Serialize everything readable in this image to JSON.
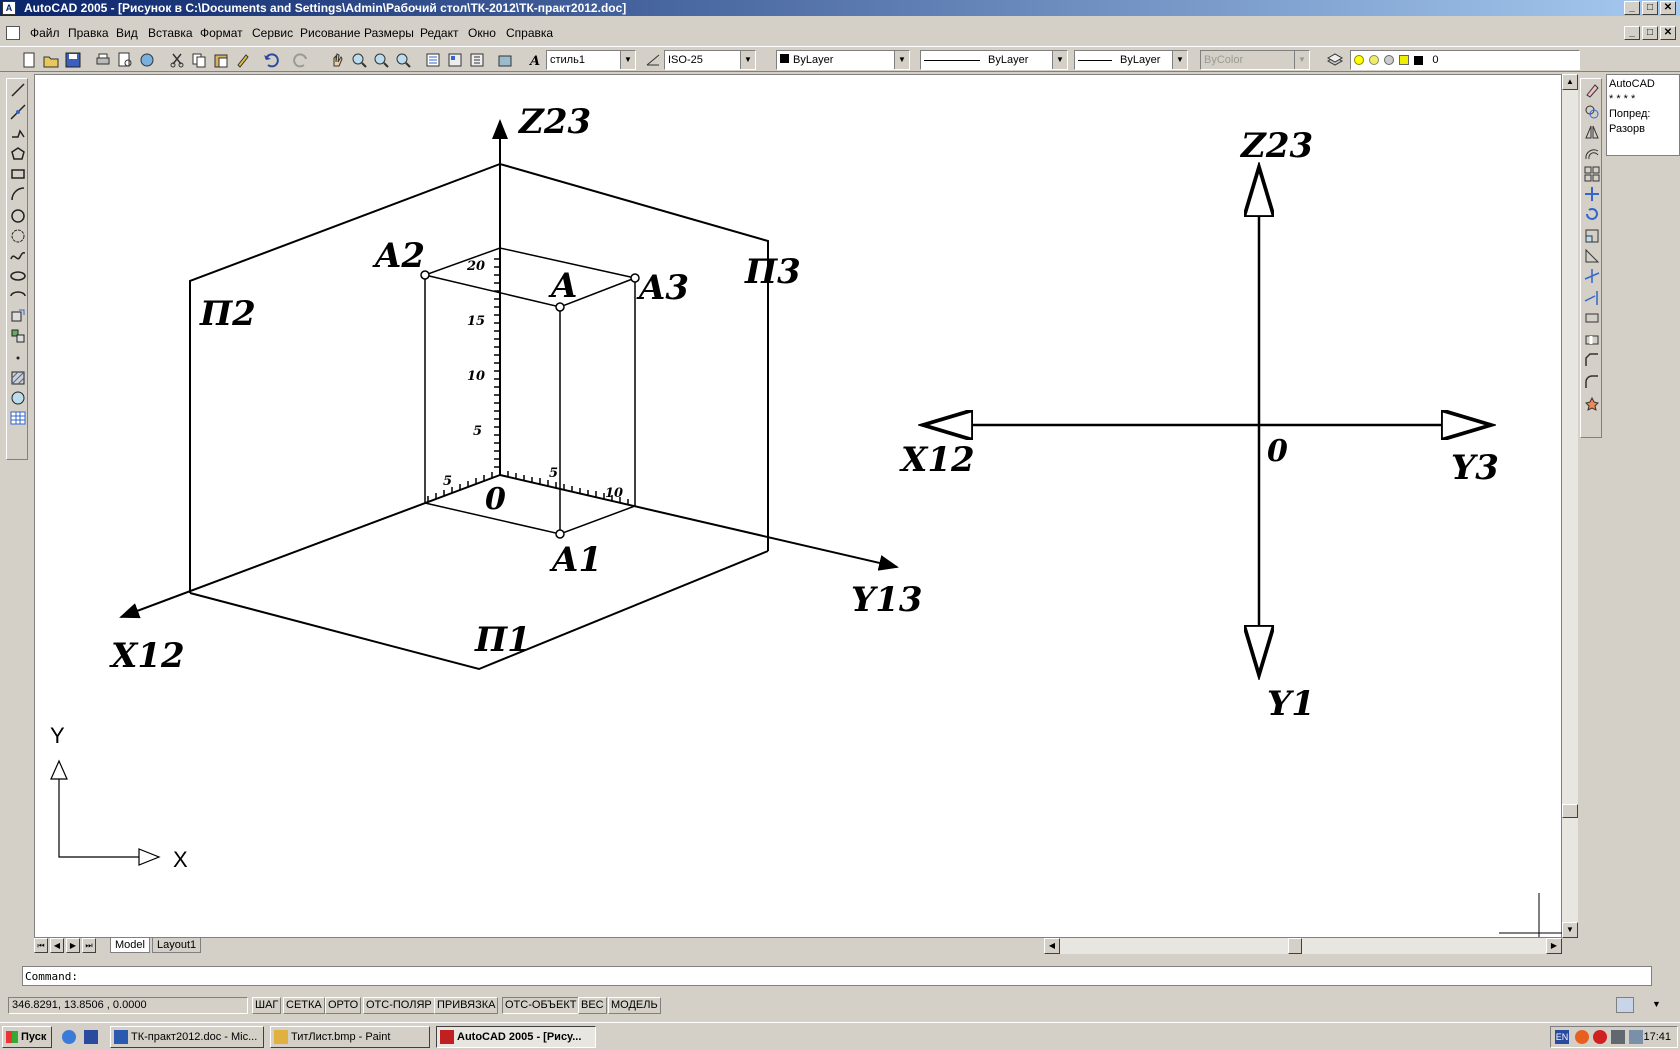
{
  "window": {
    "title": "AutoCAD 2005 - [Рисунок в C:\\Documents and Settings\\Admin\\Рабочий стол\\ТК-2012\\ТК-практ2012.doc]",
    "buttons": [
      "_",
      "□",
      "✕"
    ]
  },
  "menu": [
    "Файл",
    "Правка",
    "Вид",
    "Вставка",
    "Формат",
    "Сервис",
    "Рисование",
    "Размеры",
    "Редакт",
    "Окно",
    "Справка"
  ],
  "toolbar": {
    "text_style": "стиль1",
    "dim_style": "ISO-25",
    "color": "ByLayer",
    "linetype": "ByLayer",
    "lineweight": "ByLayer",
    "plotstyle": "ByColor",
    "layer": "0"
  },
  "drawing": {
    "left": {
      "labels": {
        "z": "Z23",
        "x": "X12",
        "y": "Y13",
        "p1": "П1",
        "p2": "П2",
        "p3": "П3",
        "a": "A",
        "a1": "A1",
        "a2": "A2",
        "a3": "A3",
        "origin": "0"
      },
      "z_ticks": [
        "5",
        "10",
        "15",
        "20"
      ],
      "x_ticks": [
        "5"
      ],
      "y_ticks": [
        "5",
        "10"
      ]
    },
    "right": {
      "labels": {
        "z": "Z23",
        "x": "X12",
        "y3": "Y3",
        "y1": "Y1",
        "origin": "0"
      }
    },
    "ucs": {
      "y": "Y",
      "x": "X"
    }
  },
  "tabs": {
    "model": "Model",
    "layout": "Layout1"
  },
  "side_panel": [
    "AutoCAD",
    "* * * *",
    "Попред:",
    "Разорв"
  ],
  "command": "Command:",
  "status": {
    "coords": "346.8291, 13.8506 , 0.0000",
    "buttons": [
      "ШАГ",
      "СЕТКА",
      "ОРТО",
      "ОТС-ПОЛЯР",
      "ПРИВЯЗКА",
      "ОТС-ОБЪЕКТ",
      "ВЕС",
      "МОДЕЛЬ"
    ]
  },
  "taskbar": {
    "start": "Пуск",
    "tasks": [
      "ТК-практ2012.doc - Mic...",
      "ТитЛист.bmp - Paint",
      "AutoCAD 2005 - [Рису..."
    ],
    "lang": "EN",
    "clock": "17:41"
  }
}
